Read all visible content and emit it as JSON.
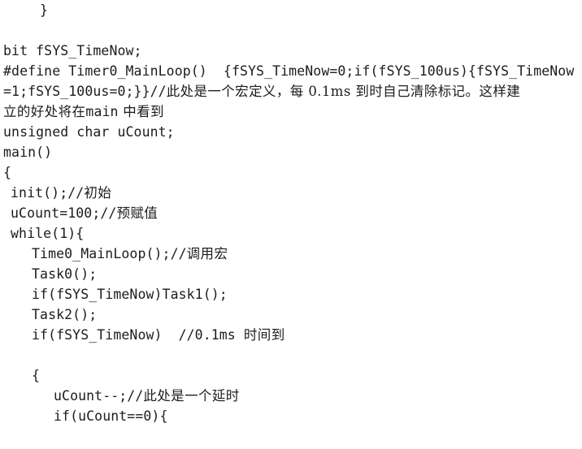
{
  "document": {
    "type": "code-listing",
    "language": "C",
    "background_color": "#ffffff",
    "text_color": "#1b1b22"
  },
  "lines": [
    {
      "id": "l01",
      "indent": "i5",
      "text": "}"
    },
    {
      "id": "l02",
      "indent": "i0",
      "text": ""
    },
    {
      "id": "l03",
      "indent": "i0",
      "text": "bit fSYS_TimeNow;"
    },
    {
      "id": "l04",
      "indent": "i0",
      "text": "#define Timer0_MainLoop()  {fSYS_TimeNow=0;if(fSYS_100us){fSYS_TimeNow"
    },
    {
      "id": "l05",
      "indent": "i0",
      "text": "=1;fSYS_100us=0;}}//",
      "cjk": "此处是一个宏定义，每 0.1ms 到时自己清除标记。这样建"
    },
    {
      "id": "l06",
      "indent": "i0",
      "cjk_lead": "立的好处将在",
      "text": "main",
      "cjk": " 中看到"
    },
    {
      "id": "l07",
      "indent": "i0",
      "text": "unsigned char uCount;"
    },
    {
      "id": "l08",
      "indent": "i0",
      "text": "main()"
    },
    {
      "id": "l09",
      "indent": "i0",
      "text": "{"
    },
    {
      "id": "l10",
      "indent": "i1",
      "text": "init();//",
      "cjk": "初始"
    },
    {
      "id": "l11",
      "indent": "i1",
      "text": "uCount=100;//",
      "cjk": "预赋值"
    },
    {
      "id": "l12",
      "indent": "i1",
      "text": "while(1){"
    },
    {
      "id": "l13",
      "indent": "i3",
      "text": "Time0_MainLoop();//",
      "cjk": "调用宏"
    },
    {
      "id": "l14",
      "indent": "i3",
      "text": "Task0();"
    },
    {
      "id": "l15",
      "indent": "i3",
      "text": "if(fSYS_TimeNow)Task1();"
    },
    {
      "id": "l16",
      "indent": "i3",
      "text": "Task2();"
    },
    {
      "id": "l17",
      "indent": "i3",
      "text": "if(fSYS_TimeNow)  //0.1ms ",
      "cjk": "时间到"
    },
    {
      "id": "l18",
      "indent": "i0",
      "text": ""
    },
    {
      "id": "l19",
      "indent": "i3",
      "text": "{"
    },
    {
      "id": "l20",
      "indent": "i4",
      "text": "uCount--;//",
      "cjk": "此处是一个延时"
    },
    {
      "id": "l21",
      "indent": "i4",
      "text": "if(uCount==0){"
    }
  ],
  "code_text": "    }\n\nbit fSYS_TimeNow;\n#define Timer0_MainLoop()  {fSYS_TimeNow=0;if(fSYS_100us){fSYS_TimeNow\n=1;fSYS_100us=0;}}//此处是一个宏定义，每 0.1ms 到时自己清除标记。这样建\n立的好处将在 main 中看到\nunsigned char uCount;\nmain()\n{\n init();//初始\n uCount=100;//预赋值\n while(1){\n   Time0_MainLoop();//调用宏\n   Task0();\n   if(fSYS_TimeNow)Task1();\n   Task2();\n   if(fSYS_TimeNow)  //0.1ms 时间到\n\n   {\n      uCount--;//此处是一个延时\n      if(uCount==0){"
}
